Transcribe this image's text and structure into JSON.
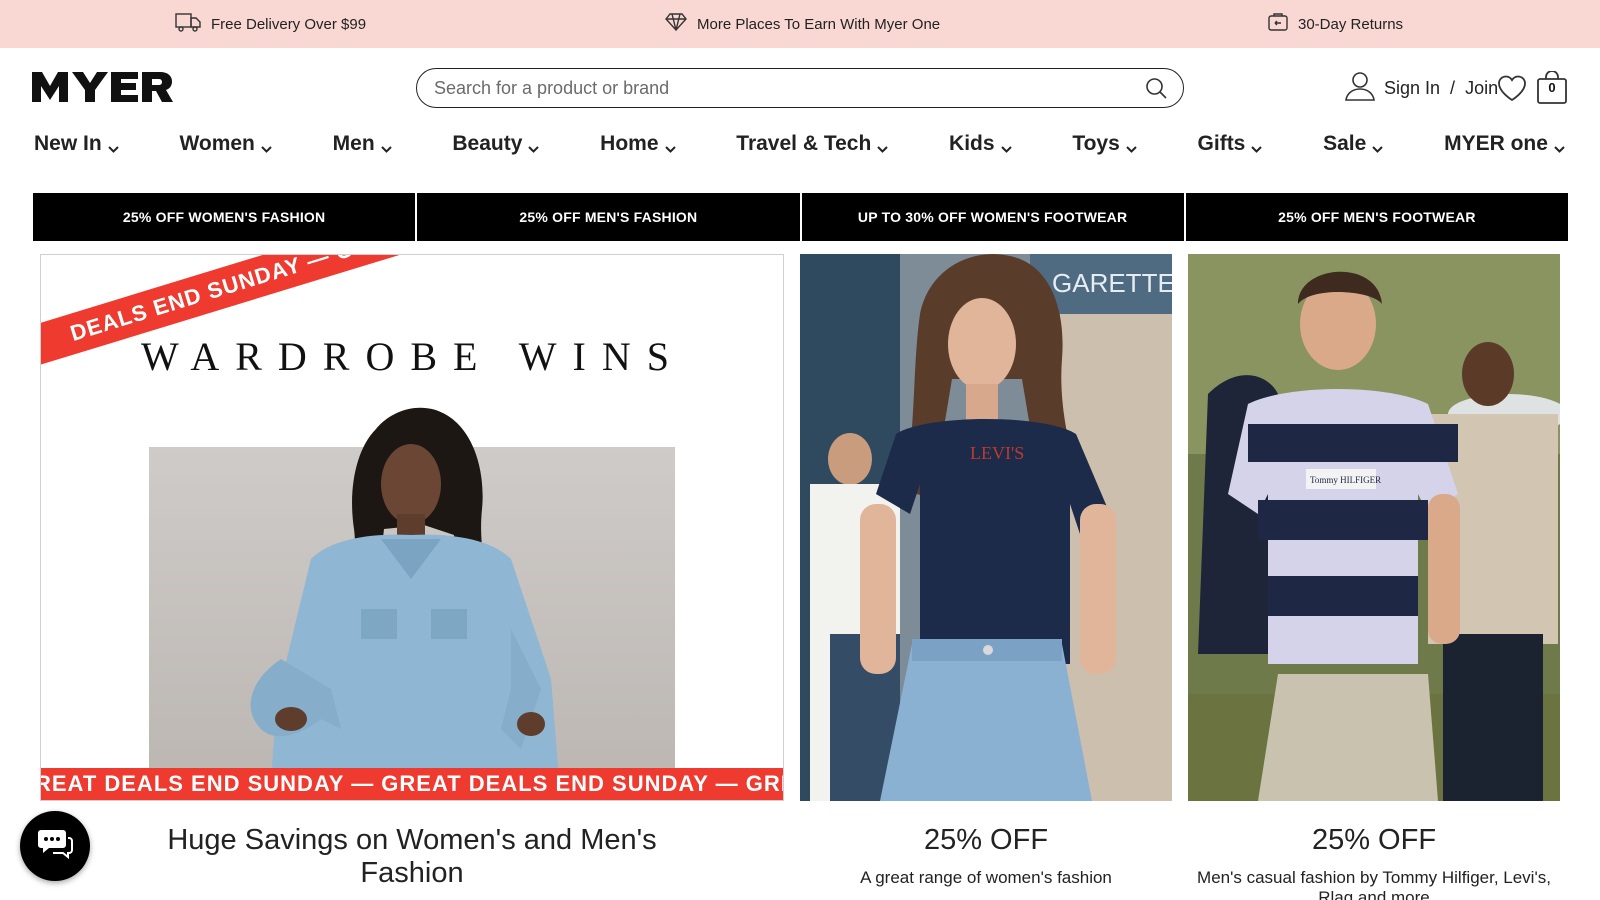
{
  "promo_bar": {
    "background": "#f9d8d3",
    "items": [
      {
        "icon": "truck-icon",
        "label": "Free Delivery Over $99"
      },
      {
        "icon": "diamond-icon",
        "label": "More Places To Earn With Myer One"
      },
      {
        "icon": "returns-icon",
        "label": "30-Day Returns"
      }
    ]
  },
  "header": {
    "logo_text": "MYER",
    "search": {
      "placeholder": "Search for a product or brand",
      "value": ""
    },
    "account": {
      "sign_in": "Sign In",
      "separator": "/",
      "join": "Join"
    },
    "bag_count": "0"
  },
  "nav": {
    "items": [
      {
        "label": "New In"
      },
      {
        "label": "Women"
      },
      {
        "label": "Men"
      },
      {
        "label": "Beauty"
      },
      {
        "label": "Home"
      },
      {
        "label": "Travel & Tech"
      },
      {
        "label": "Kids"
      },
      {
        "label": "Toys"
      },
      {
        "label": "Gifts"
      },
      {
        "label": "Sale"
      },
      {
        "label": "MYER one"
      }
    ]
  },
  "deal_tabs": [
    {
      "label": "25% OFF WOMEN'S FASHION"
    },
    {
      "label": "25% OFF MEN'S FASHION"
    },
    {
      "label": "UP TO 30% OFF WOMEN'S FOOTWEAR"
    },
    {
      "label": "25% OFF MEN'S FOOTWEAR"
    }
  ],
  "hero_cards": [
    {
      "banner_title": "WARDROBE WINS",
      "corner_ribbon": "DEALS END SUNDAY — GREAT",
      "bottom_ribbon": "REAT DEALS END SUNDAY — GREAT DEALS END SUNDAY — GREAT",
      "caption_title": "Huge Savings on Women's and Men's Fashion",
      "caption_sub": ""
    },
    {
      "caption_title": "25% OFF",
      "caption_sub": "A great range of women's fashion",
      "tee_brand": "LEVI'S",
      "storefront_text": "GARETTE"
    },
    {
      "caption_title": "25% OFF",
      "caption_sub": "Men's casual fashion by Tommy Hilfiger, Levi's, Rlag and more",
      "tee_brand": "Tommy HILFIGER"
    }
  ],
  "colors": {
    "accent_red": "#ee3a2f",
    "tab_black": "#000000",
    "promo_pink": "#f9d8d3"
  }
}
